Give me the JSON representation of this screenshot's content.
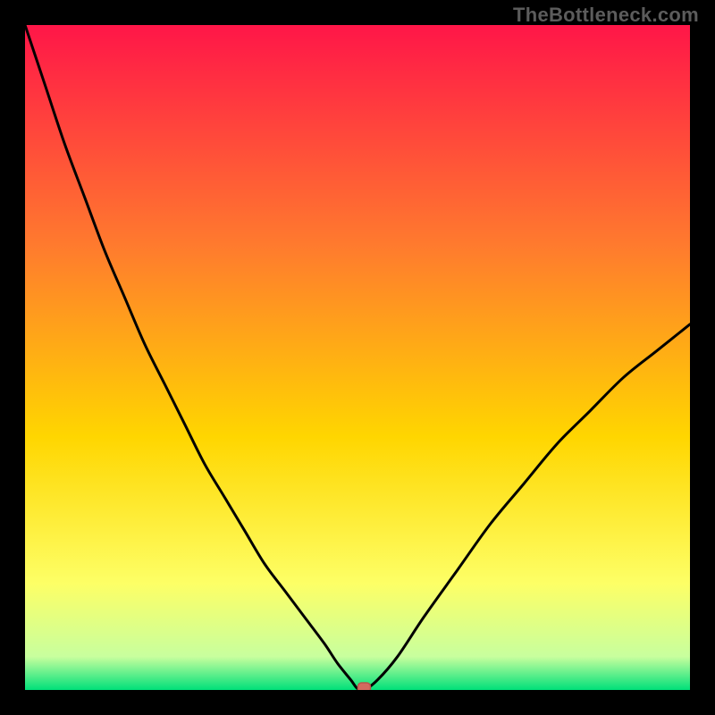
{
  "watermark": "TheBottleneck.com",
  "colors": {
    "frame": "#000000",
    "gradient_top": "#ff1648",
    "gradient_upper_mid": "#ff7a2e",
    "gradient_mid": "#ffd600",
    "gradient_lower_mid": "#fdff66",
    "gradient_near_bottom": "#c8ff9e",
    "gradient_bottom": "#00e07a",
    "curve": "#000000",
    "marker_fill": "#d46a5f",
    "marker_stroke": "#b9564c"
  },
  "chart_data": {
    "type": "line",
    "title": "",
    "xlabel": "",
    "ylabel": "",
    "xlim": [
      0,
      100
    ],
    "ylim": [
      0,
      100
    ],
    "series": [
      {
        "name": "bottleneck-curve",
        "x": [
          0,
          3,
          6,
          9,
          12,
          15,
          18,
          21,
          24,
          27,
          30,
          33,
          36,
          39,
          42,
          45,
          47,
          49,
          50,
          51,
          53,
          56,
          60,
          65,
          70,
          75,
          80,
          85,
          90,
          95,
          100
        ],
        "values": [
          100,
          91,
          82,
          74,
          66,
          59,
          52,
          46,
          40,
          34,
          29,
          24,
          19,
          15,
          11,
          7,
          4,
          1.5,
          0.2,
          0,
          1.5,
          5,
          11,
          18,
          25,
          31,
          37,
          42,
          47,
          51,
          55
        ]
      }
    ],
    "annotations": [
      {
        "name": "optimal-marker",
        "x": 51,
        "y": 0
      }
    ],
    "legend": false,
    "grid": false
  }
}
